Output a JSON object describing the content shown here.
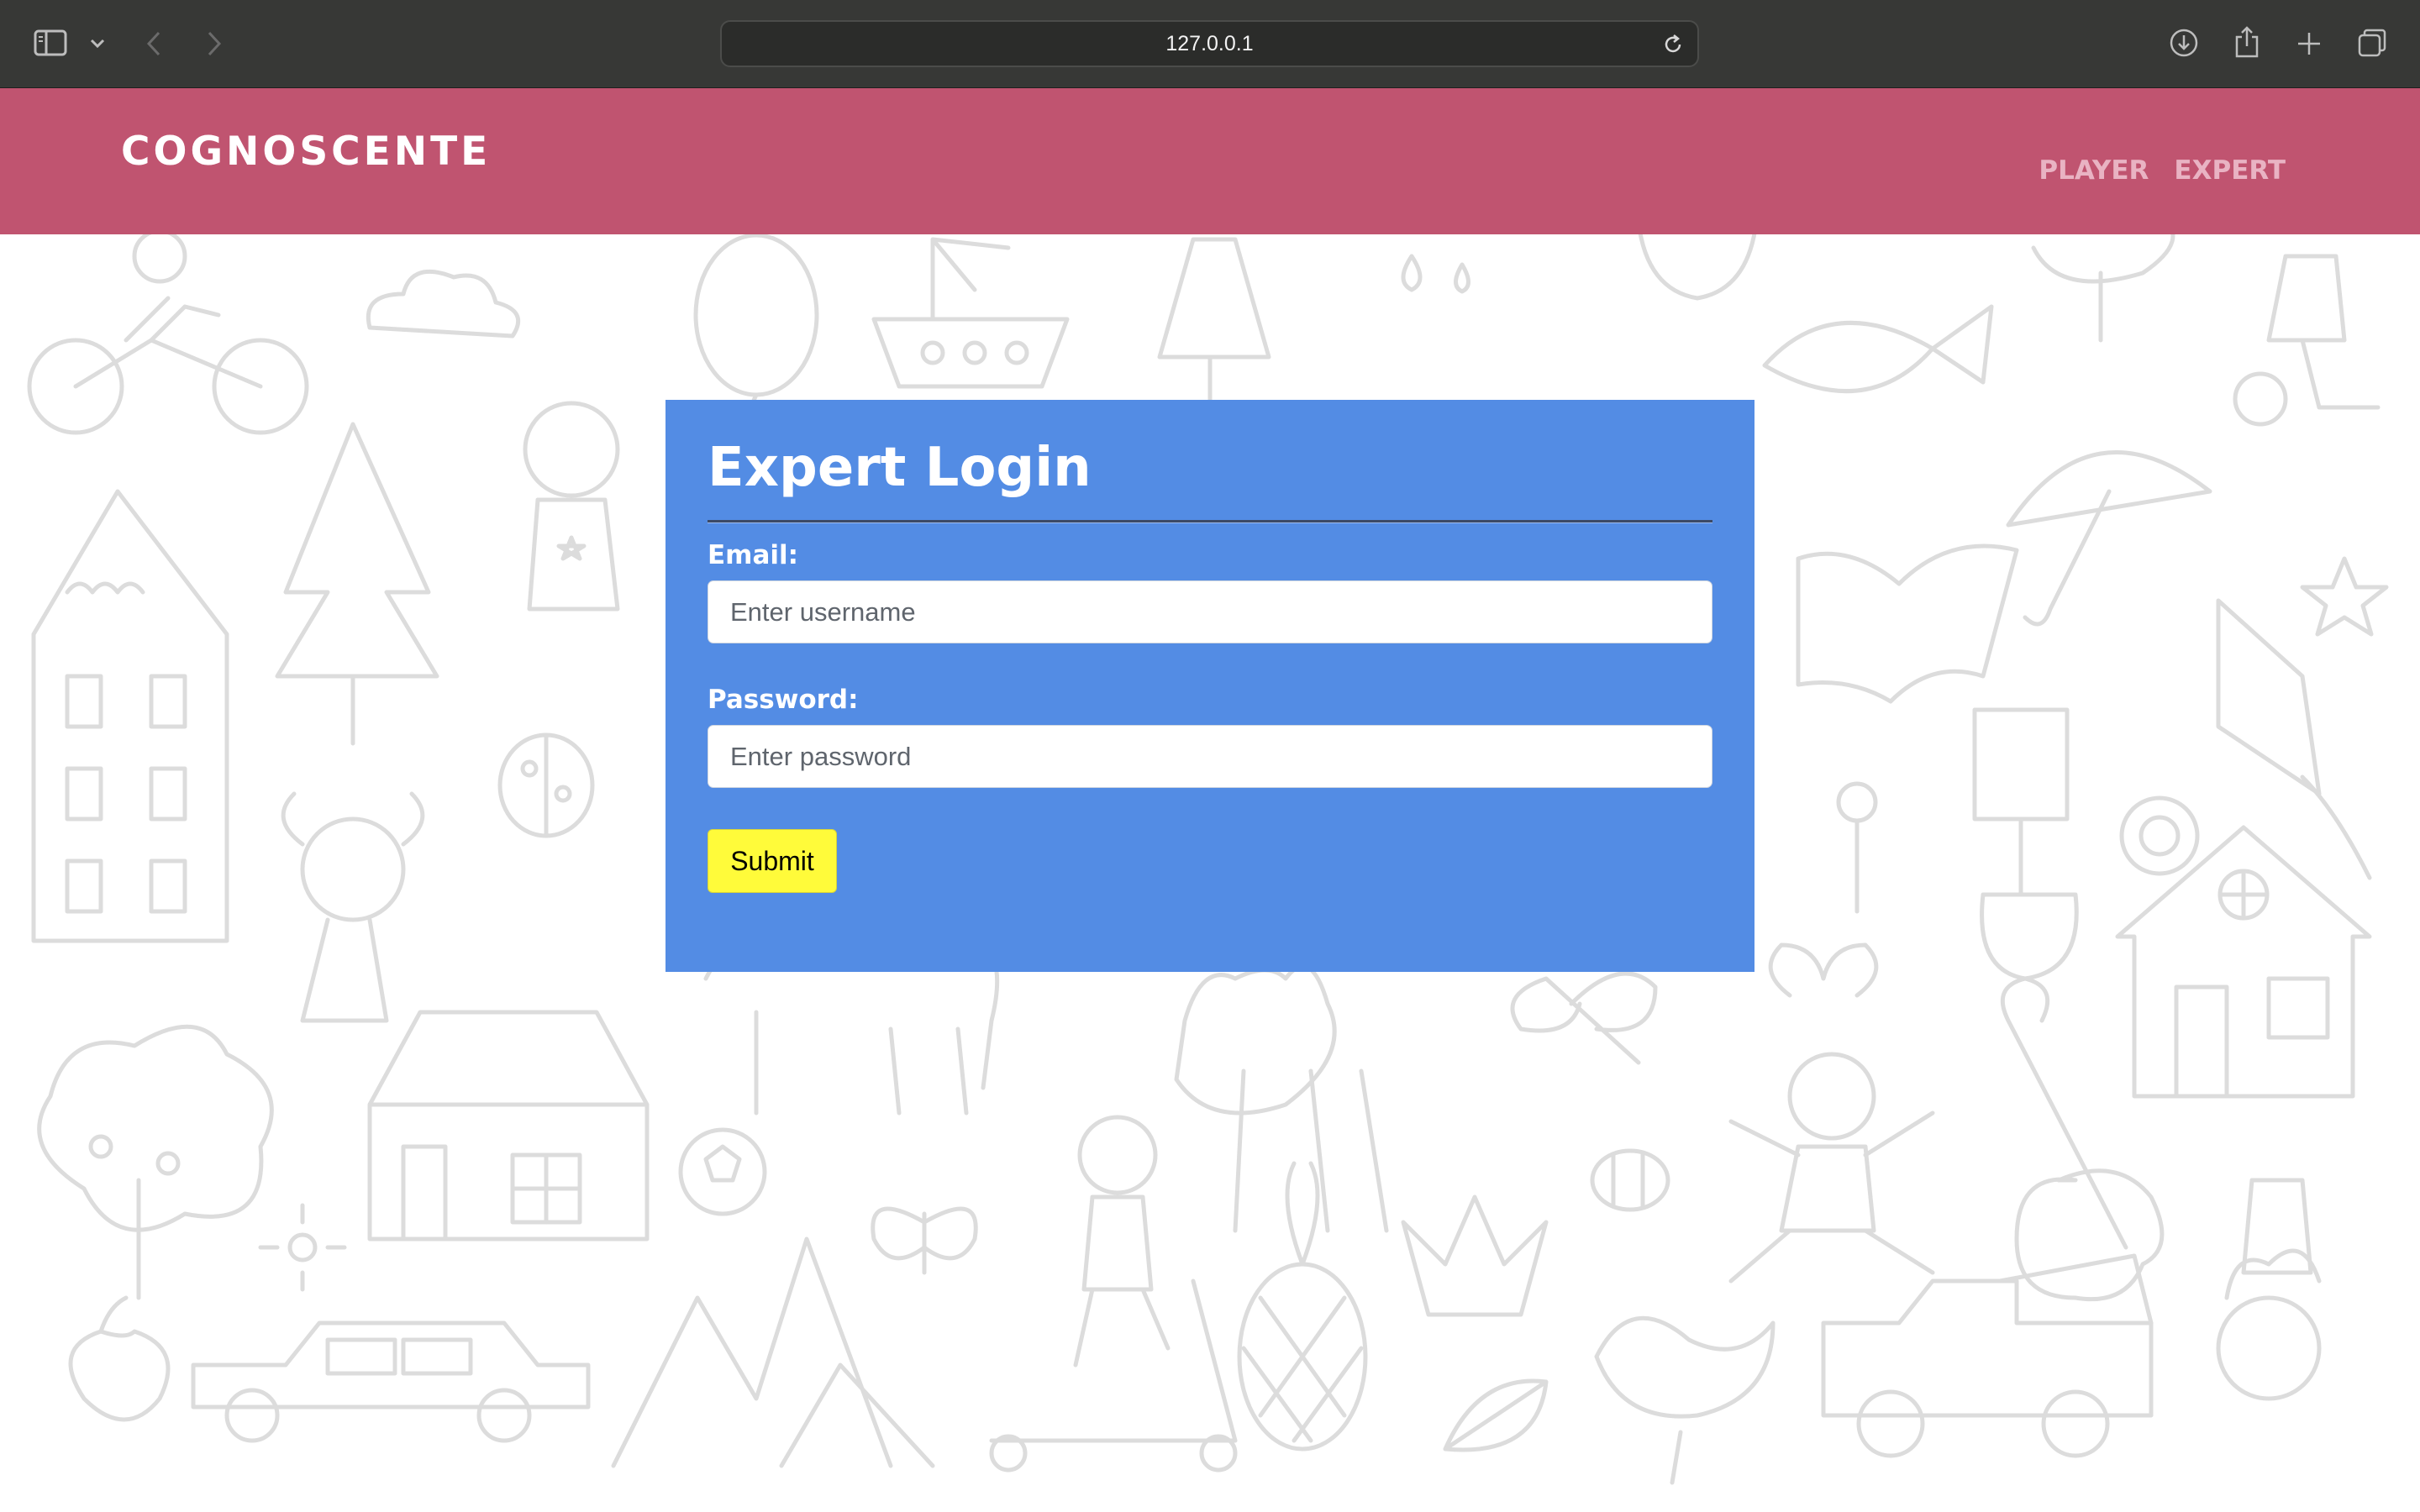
{
  "browser": {
    "url": "127.0.0.1",
    "icons": [
      "sidebar-icon",
      "chevron-down-icon",
      "back-icon",
      "forward-icon",
      "reload-icon",
      "download-icon",
      "share-icon",
      "new-tab-icon",
      "tabs-overview-icon"
    ]
  },
  "header": {
    "brand": "COGNOSCENTE",
    "nav": {
      "player": "PLAYER",
      "expert": "EXPERT"
    }
  },
  "login": {
    "title": "Expert Login",
    "email_label": "Email:",
    "email_placeholder": "Enter username",
    "email_value": "",
    "password_label": "Password:",
    "password_placeholder": "Enter password",
    "password_value": "",
    "submit_label": "Submit"
  },
  "colors": {
    "chrome": "#373836",
    "header": "#c05470",
    "nav_text": "#e9b3c3",
    "card": "#538ce4",
    "submit": "#fffb3a",
    "doodle_stroke": "#dcdcdc"
  }
}
